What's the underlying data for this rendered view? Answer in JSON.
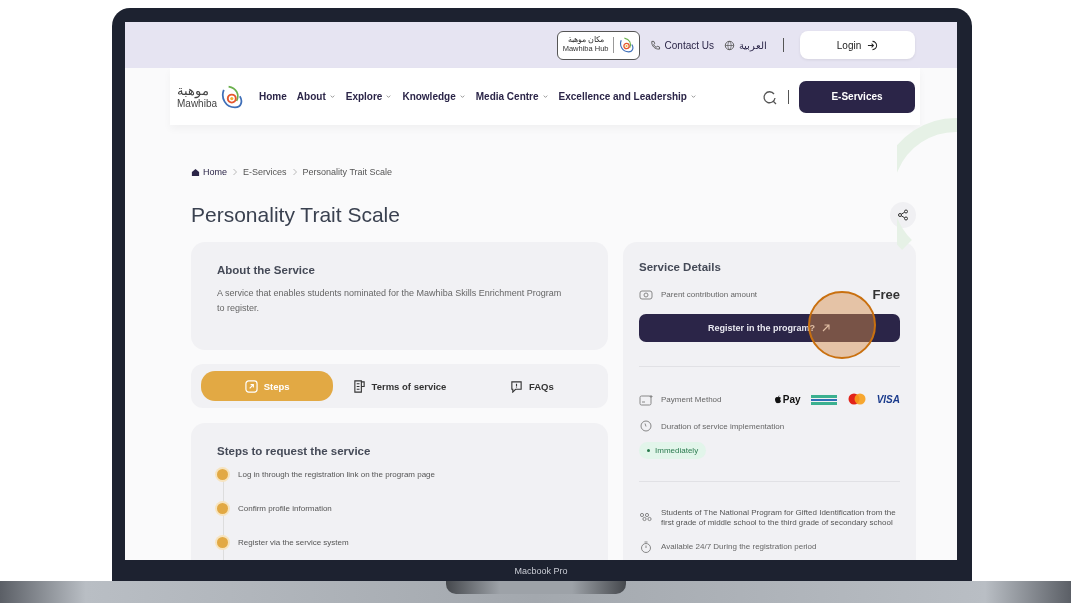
{
  "top_bar": {
    "hub_badge": {
      "arabic": "مكان موهبة",
      "english": "Mawhiba Hub"
    },
    "contact": "Contact Us",
    "language": "العربية",
    "login": "Login"
  },
  "nav": {
    "logo": {
      "arabic": "موهبة",
      "english": "Mawhiba"
    },
    "items": [
      {
        "label": "Home",
        "has_menu": false
      },
      {
        "label": "About",
        "has_menu": true
      },
      {
        "label": "Explore",
        "has_menu": true
      },
      {
        "label": "Knowledge",
        "has_menu": true
      },
      {
        "label": "Media Centre",
        "has_menu": true
      },
      {
        "label": "Excellence and Leadership",
        "has_menu": true
      }
    ],
    "e_services": "E-Services"
  },
  "breadcrumb": [
    "Home",
    "E-Services",
    "Personality Trait Scale"
  ],
  "title": "Personality Trait Scale",
  "about": {
    "heading": "About the Service",
    "text": "A service that enables students nominated for the Mawhiba Skills Enrichment Program to register."
  },
  "tabs": [
    {
      "label": "Steps",
      "kind": "steps",
      "selected": true
    },
    {
      "label": "Terms of service",
      "kind": "terms",
      "selected": false
    },
    {
      "label": "FAQs",
      "kind": "faq",
      "selected": false
    }
  ],
  "steps": {
    "heading": "Steps to request the service",
    "items": [
      "Log in through the registration link on the program page",
      "Confirm profile information",
      "Register via the service system"
    ]
  },
  "service_details": {
    "heading": "Service Details",
    "fee_label": "Parent contribution amount",
    "fee": "Free",
    "register": "Register in the program?",
    "payment_label": "Payment Method",
    "payment_methods": [
      {
        "kind": "applepay",
        "label": "Pay"
      },
      {
        "kind": "stcpay"
      },
      {
        "kind": "mastercard"
      },
      {
        "kind": "visa",
        "label": "VISA"
      }
    ],
    "duration_label": "Duration of service implementation",
    "duration": "Immediately",
    "audience": "Students of The National Program for Gifted Identification from the first grade of middle school to the third grade of secondary school",
    "availability": "Available 24/7 During the registration period"
  },
  "device_label": "Macbook Pro"
}
